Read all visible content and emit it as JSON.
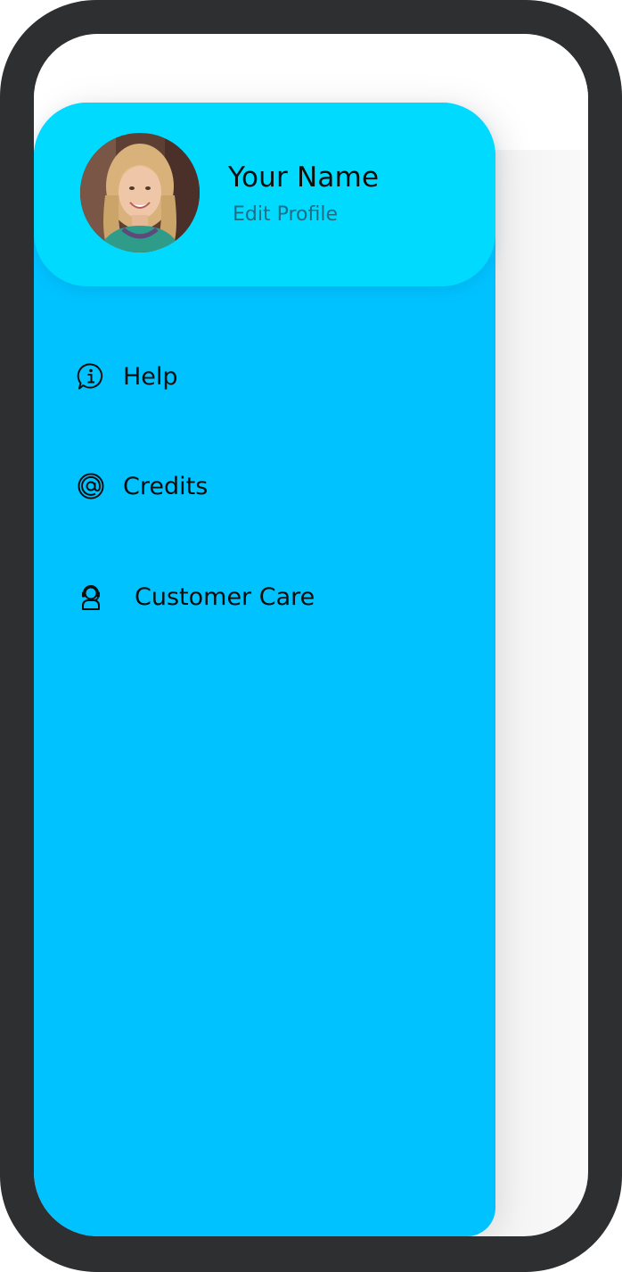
{
  "profile": {
    "name": "Your Name",
    "edit_label": "Edit Profile",
    "avatar_icon": "user-photo"
  },
  "menu": {
    "items": [
      {
        "label": "Help",
        "icon": "help-info-icon"
      },
      {
        "label": "Credits",
        "icon": "at-sign-icon"
      },
      {
        "label": "Customer Care",
        "icon": "headset-agent-icon"
      }
    ]
  },
  "colors": {
    "frame": "#2e2f31",
    "drawer": "#00c2ff",
    "header": "#00daff",
    "edit_text": "#1c6e86"
  }
}
